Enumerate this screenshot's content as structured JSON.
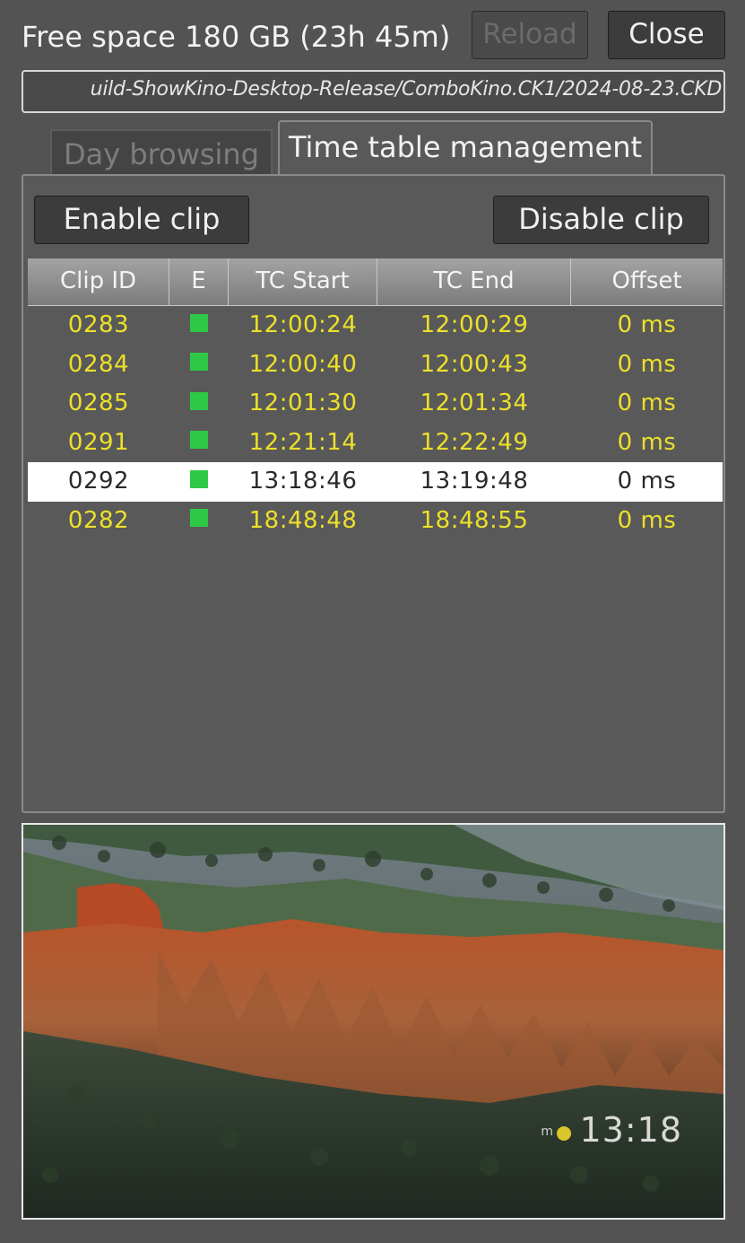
{
  "header": {
    "free_space": "Free space 180 GB (23h 45m)",
    "reload_label": "Reload",
    "close_label": "Close"
  },
  "path": {
    "value": "uild-ShowKino-Desktop-Release/ComboKino.CK1/2024-08-23.CKD"
  },
  "tabs": [
    {
      "label": "Day browsing",
      "active": false
    },
    {
      "label": "Time table management",
      "active": true
    }
  ],
  "panel": {
    "enable_label": "Enable clip",
    "disable_label": "Disable clip"
  },
  "table": {
    "columns": [
      "Clip ID",
      "E",
      "TC Start",
      "TC End",
      "Offset"
    ],
    "rows": [
      {
        "id": "0283",
        "enabled": true,
        "start": "12:00:24",
        "end": "12:00:29",
        "offset": "0 ms",
        "selected": false
      },
      {
        "id": "0284",
        "enabled": true,
        "start": "12:00:40",
        "end": "12:00:43",
        "offset": "0 ms",
        "selected": false
      },
      {
        "id": "0285",
        "enabled": true,
        "start": "12:01:30",
        "end": "12:01:34",
        "offset": "0 ms",
        "selected": false
      },
      {
        "id": "0291",
        "enabled": true,
        "start": "12:21:14",
        "end": "12:22:49",
        "offset": "0 ms",
        "selected": false
      },
      {
        "id": "0292",
        "enabled": true,
        "start": "13:18:46",
        "end": "13:19:48",
        "offset": "0 ms",
        "selected": true
      },
      {
        "id": "0282",
        "enabled": true,
        "start": "18:48:48",
        "end": "18:48:55",
        "offset": "0 ms",
        "selected": false
      }
    ],
    "colors": {
      "row_text": "#ece02a",
      "selected_text": "#2a2a2a",
      "enabled_indicator": "#2fc846"
    }
  },
  "preview": {
    "clock": "13:18"
  }
}
